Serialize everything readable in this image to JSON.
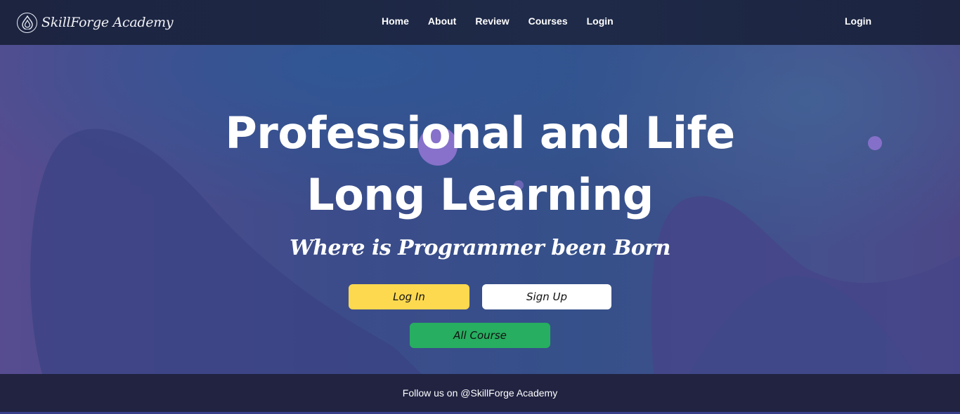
{
  "nav": {
    "brand": "SkillForge Academy",
    "brand_icon": "flame-drop-icon",
    "links": [
      "Home",
      "About",
      "Review",
      "Courses",
      "Login"
    ],
    "login": "Login"
  },
  "hero": {
    "title_line1": "Professional and Life",
    "title_line2": "Long Learning",
    "subtitle": "Where is Programmer been Born",
    "buttons": {
      "login": "Log In",
      "signup": "Sign Up",
      "all_course": "All Course"
    }
  },
  "footer": {
    "text": "Follow us on @SkillForge Academy"
  },
  "colors": {
    "login_button": "#fdd94f",
    "signup_button": "#ffffff",
    "all_course_button": "#27ae60",
    "navbar": "#1e2a48",
    "footer": "#212341"
  }
}
